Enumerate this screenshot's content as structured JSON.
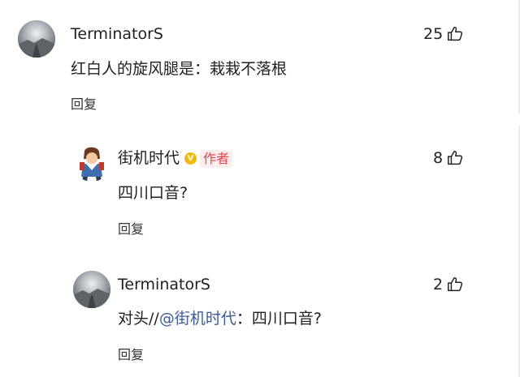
{
  "comments": [
    {
      "username": "TerminatorS",
      "text": "红白人的旋风腿是：栽栽不落根",
      "likes": "25",
      "reply_label": "回复"
    },
    {
      "username": "街机时代",
      "verified_mark": "V",
      "badge": "作者",
      "text": "四川口音?",
      "likes": "8",
      "reply_label": "回复"
    },
    {
      "username": "TerminatorS",
      "text_prefix": "对头//",
      "mention": "@街机时代",
      "text_suffix": "：四川口音?",
      "likes": "2",
      "reply_label": "回复"
    }
  ],
  "icons": {
    "like": "thumbs-up-icon",
    "verified": "verified-badge-icon"
  },
  "colors": {
    "mention": "#3b5b9a",
    "author_badge_text": "#e8434a",
    "author_badge_bg": "#fdeeee",
    "verified": "#f5b800"
  }
}
